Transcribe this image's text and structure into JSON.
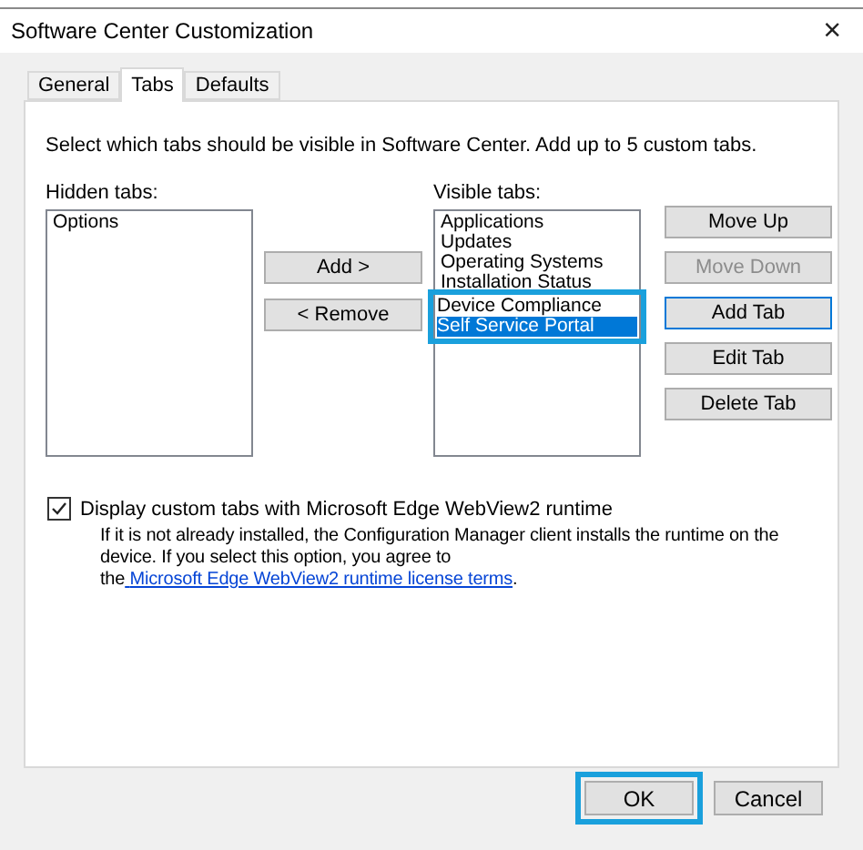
{
  "window": {
    "title": "Software Center Customization",
    "close": "×"
  },
  "tabs": [
    {
      "label": "General",
      "selected": false
    },
    {
      "label": "Tabs",
      "selected": true
    },
    {
      "label": "Defaults",
      "selected": false
    }
  ],
  "instruction": "Select which tabs should be visible in Software Center. Add up to 5 custom tabs.",
  "hidden_tabs": {
    "label": "Hidden tabs:",
    "items": [
      {
        "label": "Options",
        "selected": false
      }
    ]
  },
  "move_buttons": [
    {
      "label": "Add >",
      "disabled": false
    },
    {
      "label": "< Remove",
      "disabled": false
    }
  ],
  "visible_tabs": {
    "label": "Visible tabs:",
    "items": [
      {
        "label": "Applications",
        "selected": false,
        "highlighted": false
      },
      {
        "label": "Updates",
        "selected": false,
        "highlighted": false
      },
      {
        "label": "Operating Systems",
        "selected": false,
        "highlighted": false
      },
      {
        "label": "Installation Status",
        "selected": false,
        "highlighted": false
      },
      {
        "label": "Device Compliance",
        "selected": false,
        "highlighted": true
      },
      {
        "label": "Self Service Portal",
        "selected": true,
        "highlighted": true
      }
    ]
  },
  "side_buttons": [
    {
      "label": "Move Up",
      "disabled": false,
      "focused": false
    },
    {
      "label": "Move Down",
      "disabled": true,
      "focused": false
    },
    {
      "label": "Add Tab",
      "disabled": false,
      "focused": true
    },
    {
      "label": "Edit Tab",
      "disabled": false,
      "focused": false
    },
    {
      "label": "Delete Tab",
      "disabled": false,
      "focused": false
    }
  ],
  "webview_option": {
    "label": "Display custom tabs with Microsoft Edge WebView2 runtime",
    "checked": true,
    "description": "If it is not already installed, the Configuration Manager client installs the runtime on the device. If you select this option, you agree to the",
    "link": "Microsoft Edge WebView2 runtime license terms",
    "after_link": "."
  },
  "footer_buttons": [
    {
      "label": "OK",
      "highlighted": true
    },
    {
      "label": "Cancel",
      "highlighted": false
    }
  ]
}
